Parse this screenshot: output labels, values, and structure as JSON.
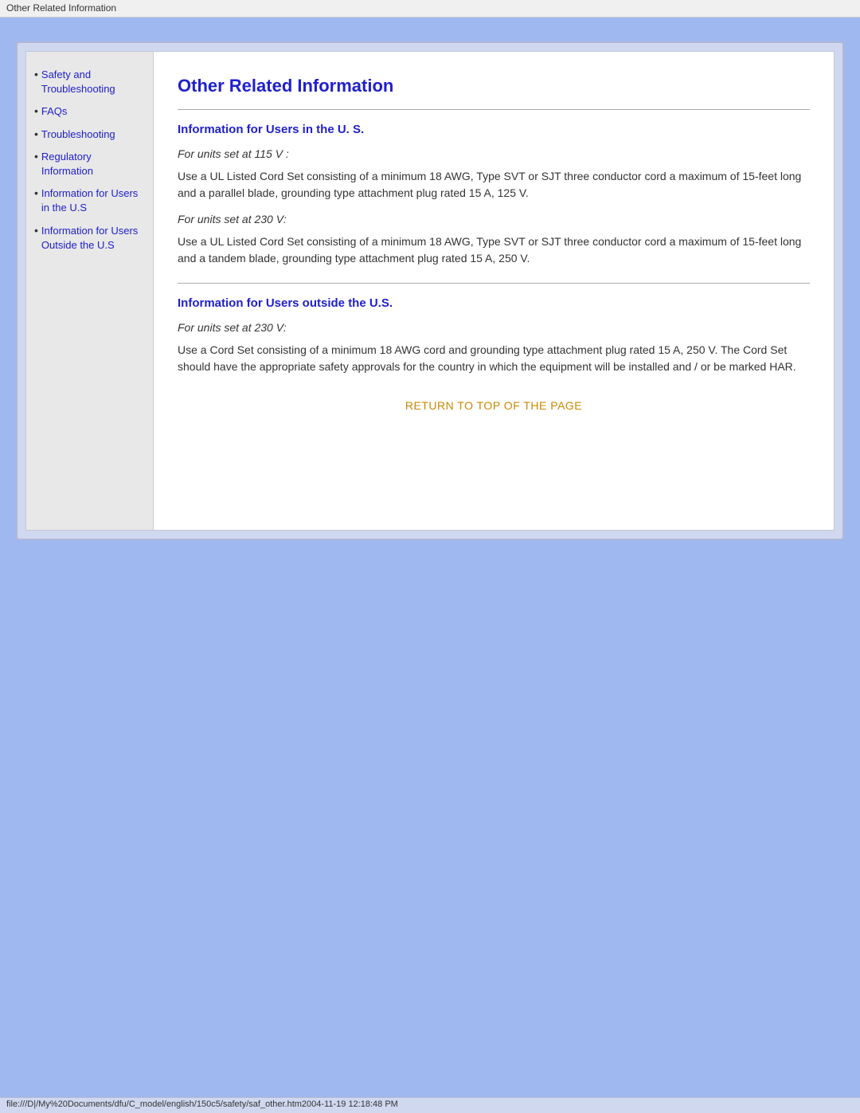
{
  "titlebar": {
    "text": "Other Related Information"
  },
  "sidebar": {
    "items": [
      {
        "label": "Safety and Troubleshooting",
        "href": "#"
      },
      {
        "label": "FAQs",
        "href": "#"
      },
      {
        "label": "Troubleshooting",
        "href": "#"
      },
      {
        "label": "Regulatory Information",
        "href": "#"
      },
      {
        "label": "Information for Users in the U.S",
        "href": "#"
      },
      {
        "label": "Information for Users Outside the U.S",
        "href": "#"
      }
    ]
  },
  "main": {
    "page_title": "Other Related Information",
    "section1": {
      "title": "Information for Users in the U. S.",
      "subsection1": {
        "italic": "For units set at 115 V :",
        "body": "Use a UL Listed Cord Set consisting of a minimum 18 AWG, Type SVT or SJT three conductor cord a maximum of 15-feet long and a parallel blade, grounding type attachment plug rated 15 A, 125 V."
      },
      "subsection2": {
        "italic": "For units set at 230 V:",
        "body": "Use a UL Listed Cord Set consisting of a minimum 18 AWG, Type SVT or SJT three conductor cord a maximum of 15-feet long and a tandem blade, grounding type attachment plug rated 15 A, 250 V."
      }
    },
    "section2": {
      "title": "Information for Users outside the U.S.",
      "subsection1": {
        "italic": "For units set at 230 V:",
        "body": "Use a Cord Set consisting of a minimum 18 AWG cord and grounding type attachment plug rated 15 A, 250 V. The Cord Set should have the appropriate safety approvals for the country in which the equipment will be installed and / or be marked HAR."
      }
    },
    "return_link": "RETURN TO TOP OF THE PAGE"
  },
  "statusbar": {
    "text": "file:///D|/My%20Documents/dfu/C_model/english/150c5/safety/saf_other.htm2004-11-19  12:18:48 PM"
  }
}
